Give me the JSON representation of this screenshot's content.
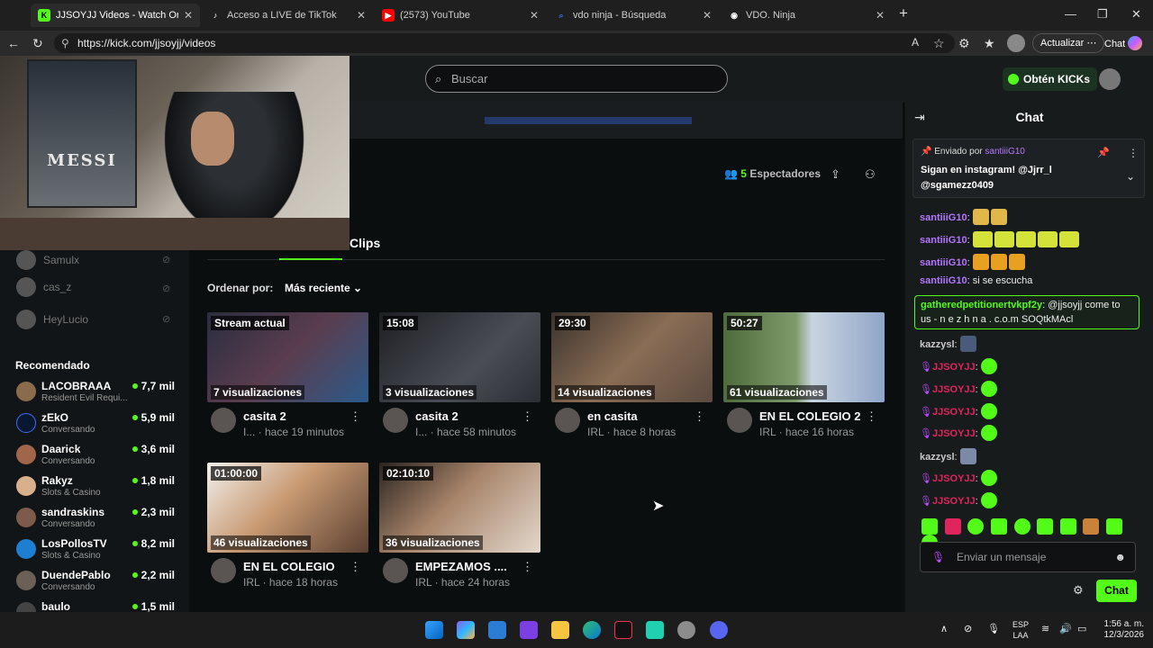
{
  "browser": {
    "tabs": [
      {
        "label": "JJSOYJJ Videos - Watch On-Deman",
        "icon": "kick-favicon",
        "color": "#53fc18",
        "glyph": "K"
      },
      {
        "label": "Acceso a LIVE de TikTok",
        "icon": "tiktok-favicon",
        "color": "#ffffff",
        "glyph": "♪"
      },
      {
        "label": "(2573) YouTube",
        "icon": "youtube-favicon",
        "color": "#ff0000",
        "glyph": "▶"
      },
      {
        "label": "vdo ninja - Búsqueda",
        "icon": "search-favicon",
        "color": "#3a6ff7",
        "glyph": "⌕"
      },
      {
        "label": "VDO. Ninja",
        "icon": "vdo-ninja-favicon",
        "color": "#ffffff",
        "glyph": "◉"
      }
    ],
    "url": "https://kick.com/jjsoyjj/videos",
    "update_label": "Actualizar",
    "chat_label": "Chat"
  },
  "kick": {
    "search_placeholder": "Buscar",
    "kicks_label": "Obtén KICKs",
    "viewers_count": "5",
    "viewers_label": "Espectadores",
    "clips_tab": "Clips",
    "sort_label": "Ordenar por:",
    "sort_value": "Más reciente"
  },
  "sidebar": {
    "following": [
      "Samulx",
      "cas_z",
      "HeyLucio"
    ],
    "recommended_title": "Recomendado",
    "recommended": [
      {
        "name": "LACOBRAAA",
        "sub": "Resident Evil Requi...",
        "viewers": "7,7 mil"
      },
      {
        "name": "zEkO",
        "sub": "Conversando",
        "viewers": "5,9 mil"
      },
      {
        "name": "Daarick",
        "sub": "Conversando",
        "viewers": "3,6 mil"
      },
      {
        "name": "Rakyz",
        "sub": "Slots & Casino",
        "viewers": "1,8 mil"
      },
      {
        "name": "sandraskins",
        "sub": "Conversando",
        "viewers": "2,3 mil"
      },
      {
        "name": "LosPollosTV",
        "sub": "Slots & Casino",
        "viewers": "8,2 mil"
      },
      {
        "name": "DuendePablo",
        "sub": "Conversando",
        "viewers": "2,2 mil"
      },
      {
        "name": "baulo",
        "sub": "",
        "viewers": "1,5 mil"
      }
    ]
  },
  "videos": [
    {
      "duration": "Stream actual",
      "views": "7 visualizaciones",
      "title": "casita 2",
      "meta": "I... · hace 19 minutos",
      "thumb": "#3b3f58"
    },
    {
      "duration": "15:08",
      "views": "3 visualizaciones",
      "title": "casita 2",
      "meta": "I... · hace 58 minutos",
      "thumb": "#2d2f33"
    },
    {
      "duration": "29:30",
      "views": "14 visualizaciones",
      "title": "en casita",
      "meta": "IRL · hace 8 horas",
      "thumb": "#4a4036"
    },
    {
      "duration": "50:27",
      "views": "61 visualizaciones",
      "title": "EN EL COLEGIO 2",
      "meta": "IRL · hace 16 horas",
      "thumb": "#6f8a5a"
    },
    {
      "duration": "01:00:00",
      "views": "46 visualizaciones",
      "title": "EN EL COLEGIO",
      "meta": "IRL · hace 18 horas",
      "thumb": "#b07a55"
    },
    {
      "duration": "02:10:10",
      "views": "36 visualizaciones",
      "title": "EMPEZAMOS ....",
      "meta": "IRL · hace 24 horas",
      "thumb": "#8a7a6a"
    }
  ],
  "chat": {
    "title": "Chat",
    "pinned_by_label": "Enviado por",
    "pinned_by_user": "santiiiG10",
    "pinned_text_1": "Sigan en instagram! @Jjrr_l",
    "pinned_text_2": "@sgamezz0409",
    "messages": [
      {
        "user": "santiiiG10",
        "text": "",
        "color": "#b377ff"
      },
      {
        "user": "santiiiG10",
        "text": "",
        "color": "#b377ff"
      },
      {
        "user": "santiiiG10",
        "text": "",
        "color": "#b377ff"
      },
      {
        "user": "santiiiG10",
        "text": "si se escucha",
        "color": "#b377ff"
      }
    ],
    "highlight_user": "gatheredpetitionertvkpf2y",
    "highlight_text_1": "@jjsoyjj come to",
    "highlight_text_2": "us - n e z h n a . c.o.m SOQtkMAcl",
    "later_messages": [
      {
        "user": "kazzysl",
        "text": "",
        "color": "#c9c9c9"
      },
      {
        "user": "JJSOYJJ",
        "text": "",
        "color": "#e0245e"
      },
      {
        "user": "JJSOYJJ",
        "text": "",
        "color": "#e0245e"
      },
      {
        "user": "JJSOYJJ",
        "text": "",
        "color": "#e0245e"
      },
      {
        "user": "JJSOYJJ",
        "text": "",
        "color": "#e0245e"
      },
      {
        "user": "kazzysl",
        "text": "",
        "color": "#c9c9c9"
      },
      {
        "user": "JJSOYJJ",
        "text": "",
        "color": "#e0245e"
      },
      {
        "user": "JJSOYJJ",
        "text": "",
        "color": "#e0245e"
      }
    ],
    "input_placeholder": "Enviar un mensaje",
    "send_label": "Chat"
  },
  "taskbar": {
    "lang_1": "ESP",
    "lang_2": "LAA",
    "time": "1:56 a. m.",
    "date": "12/3/2026"
  },
  "colors": {
    "accent": "#53fc18"
  }
}
